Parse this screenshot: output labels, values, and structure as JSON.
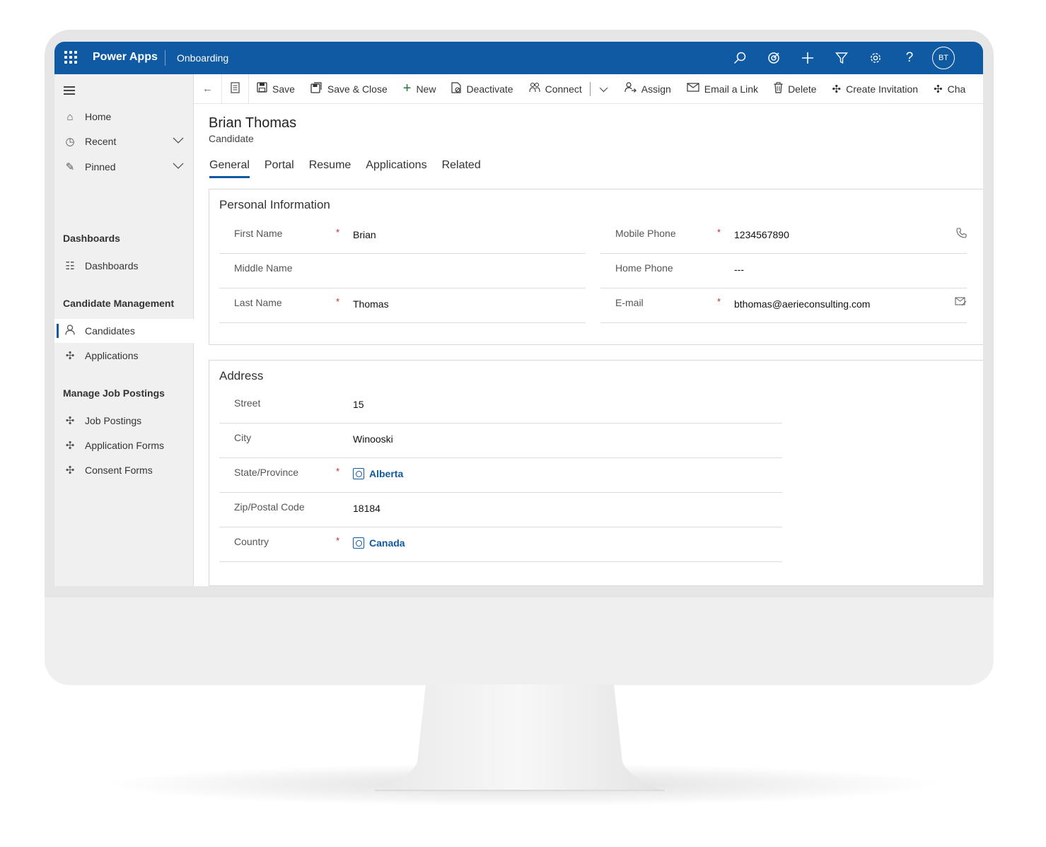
{
  "app": {
    "name": "Power Apps",
    "module": "Onboarding",
    "user_initials": "BT"
  },
  "topbar_icons": [
    "search-icon",
    "target-icon",
    "plus-icon",
    "filter-icon",
    "gear-icon",
    "help-icon"
  ],
  "sidebar": {
    "home": "Home",
    "recent": "Recent",
    "pinned": "Pinned",
    "group_dashboards": "Dashboards",
    "dashboards": "Dashboards",
    "group_candidate": "Candidate Management",
    "candidates": "Candidates",
    "applications": "Applications",
    "group_jobs": "Manage Job Postings",
    "job_postings": "Job Postings",
    "application_forms": "Application Forms",
    "consent_forms": "Consent Forms"
  },
  "commands": {
    "save": "Save",
    "save_close": "Save & Close",
    "new": "New",
    "deactivate": "Deactivate",
    "connect": "Connect",
    "assign": "Assign",
    "email_link": "Email a Link",
    "delete": "Delete",
    "create_invitation": "Create Invitation",
    "cha": "Cha"
  },
  "record": {
    "title": "Brian Thomas",
    "type": "Candidate"
  },
  "tabs": [
    "General",
    "Portal",
    "Resume",
    "Applications",
    "Related"
  ],
  "personal": {
    "title": "Personal Information",
    "first_name_label": "First Name",
    "first_name": "Brian",
    "middle_name_label": "Middle Name",
    "middle_name": "",
    "last_name_label": "Last Name",
    "last_name": "Thomas",
    "mobile_label": "Mobile Phone",
    "mobile": "1234567890",
    "home_label": "Home Phone",
    "home": "---",
    "email_label": "E-mail",
    "email": "bthomas@aerieconsulting.com"
  },
  "address": {
    "title": "Address",
    "street_label": "Street",
    "street": "15",
    "city_label": "City",
    "city": "Winooski",
    "state_label": "State/Province",
    "state": "Alberta",
    "zip_label": "Zip/Postal Code",
    "zip": "18184",
    "country_label": "Country",
    "country": "Canada"
  },
  "required_mark": "*",
  "colors": {
    "brand": "#0f5aa3",
    "required": "#c4262e",
    "new_icon": "#1b7d3a"
  }
}
